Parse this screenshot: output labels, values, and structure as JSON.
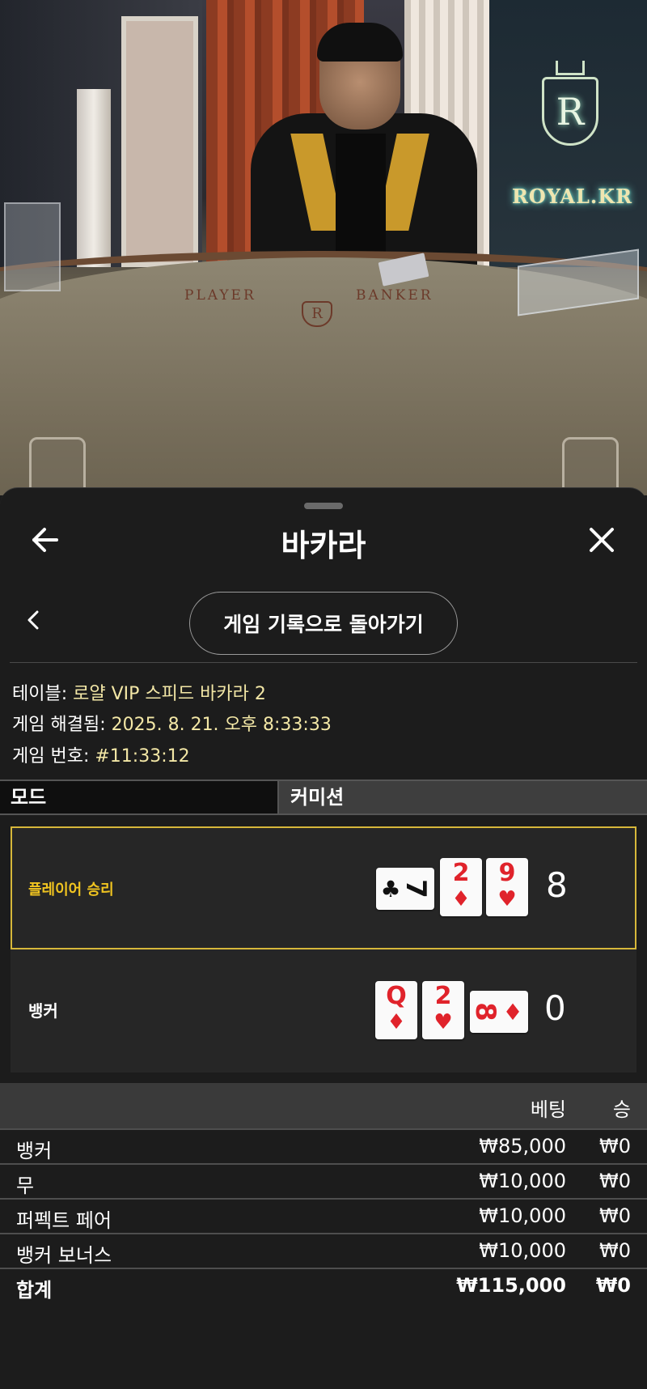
{
  "video": {
    "brand": "ROYAL.KR",
    "logo_letter": "R",
    "table_player": "PLAYER",
    "table_banker": "BANKER"
  },
  "header": {
    "title": "바카라",
    "back_icon": "arrow-left-icon",
    "close_icon": "close-icon"
  },
  "nav": {
    "return_label": "게임 기록으로 돌아가기"
  },
  "info": {
    "table_label": "테이블: ",
    "table_value": "로얄 VIP 스피드 바카라 2",
    "resolved_label": "게임 해결됨: ",
    "resolved_value": "2025. 8. 21. 오후 8:33:33",
    "number_label": "게임 번호: ",
    "number_value": "#11:33:12"
  },
  "mode": {
    "label": "모드",
    "value": "커미션"
  },
  "hands": {
    "player": {
      "label": "플레이어 승리",
      "score": "8",
      "cards": [
        {
          "rank": "7",
          "suit": "♣",
          "color": "black",
          "orientation": "sideways"
        },
        {
          "rank": "2",
          "suit": "♦",
          "color": "red",
          "orientation": "upright"
        },
        {
          "rank": "9",
          "suit": "♥",
          "color": "red",
          "orientation": "upright"
        }
      ]
    },
    "banker": {
      "label": "뱅커",
      "score": "0",
      "cards": [
        {
          "rank": "Q",
          "suit": "♦",
          "color": "red",
          "orientation": "upright"
        },
        {
          "rank": "2",
          "suit": "♥",
          "color": "red",
          "orientation": "upright"
        },
        {
          "rank": "8",
          "suit": "♦",
          "color": "red",
          "orientation": "sideways"
        }
      ]
    }
  },
  "bets": {
    "headers": {
      "bet": "베팅",
      "win": "승"
    },
    "rows": [
      {
        "name": "뱅커",
        "bet": "₩85,000",
        "win": "₩0"
      },
      {
        "name": "무",
        "bet": "₩10,000",
        "win": "₩0"
      },
      {
        "name": "퍼펙트 페어",
        "bet": "₩10,000",
        "win": "₩0"
      },
      {
        "name": "뱅커 보너스",
        "bet": "₩10,000",
        "win": "₩0"
      }
    ],
    "total": {
      "name": "합계",
      "bet": "₩115,000",
      "win": "₩0"
    }
  },
  "colors": {
    "accent_gold": "#d6b73a",
    "value_text": "#f3e7a6",
    "card_red": "#e0232b"
  }
}
